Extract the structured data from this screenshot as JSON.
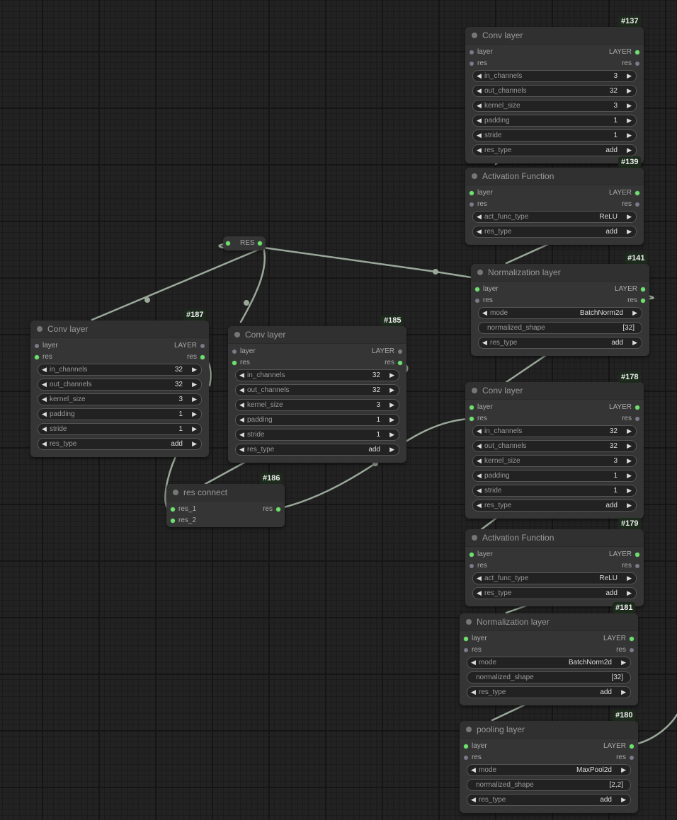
{
  "canvas": {
    "link_color": "#9aa89a",
    "slot_active_color": "#6ee06e",
    "slot_inactive_color": "#7a7a8a",
    "node_bg": "#353535",
    "badge_bg": "#1b2a1b"
  },
  "reroute": {
    "label": "RES"
  },
  "nodes": {
    "n137": {
      "id": "#137",
      "title": "Conv layer",
      "inputs": [
        "layer",
        "res"
      ],
      "outputs": [
        "LAYER",
        "res"
      ],
      "widgets": [
        {
          "name": "in_channels",
          "value": "3"
        },
        {
          "name": "out_channels",
          "value": "32"
        },
        {
          "name": "kernel_size",
          "value": "3"
        },
        {
          "name": "padding",
          "value": "1"
        },
        {
          "name": "stride",
          "value": "1"
        },
        {
          "name": "res_type",
          "value": "add"
        }
      ]
    },
    "n139": {
      "id": "#139",
      "title": "Activation Function",
      "inputs": [
        "layer",
        "res"
      ],
      "outputs": [
        "LAYER",
        "res"
      ],
      "widgets": [
        {
          "name": "act_func_type",
          "value": "ReLU"
        },
        {
          "name": "res_type",
          "value": "add"
        }
      ]
    },
    "n141": {
      "id": "#141",
      "title": "Normalization layer",
      "inputs": [
        "layer",
        "res"
      ],
      "outputs": [
        "LAYER",
        "res"
      ],
      "widgets": [
        {
          "name": "mode",
          "value": "BatchNorm2d"
        },
        {
          "name": "normalized_shape",
          "value": "[32]"
        },
        {
          "name": "res_type",
          "value": "add"
        }
      ]
    },
    "n187": {
      "id": "#187",
      "title": "Conv layer",
      "inputs": [
        "layer",
        "res"
      ],
      "outputs": [
        "LAYER",
        "res"
      ],
      "widgets": [
        {
          "name": "in_channels",
          "value": "32"
        },
        {
          "name": "out_channels",
          "value": "32"
        },
        {
          "name": "kernel_size",
          "value": "3"
        },
        {
          "name": "padding",
          "value": "1"
        },
        {
          "name": "stride",
          "value": "1"
        },
        {
          "name": "res_type",
          "value": "add"
        }
      ]
    },
    "n185": {
      "id": "#185",
      "title": "Conv layer",
      "inputs": [
        "layer",
        "res"
      ],
      "outputs": [
        "LAYER",
        "res"
      ],
      "widgets": [
        {
          "name": "in_channels",
          "value": "32"
        },
        {
          "name": "out_channels",
          "value": "32"
        },
        {
          "name": "kernel_size",
          "value": "3"
        },
        {
          "name": "padding",
          "value": "1"
        },
        {
          "name": "stride",
          "value": "1"
        },
        {
          "name": "res_type",
          "value": "add"
        }
      ]
    },
    "n186": {
      "id": "#186",
      "title": "res connect",
      "inputs": [
        "res_1",
        "res_2"
      ],
      "outputs": [
        "res"
      ]
    },
    "n178": {
      "id": "#178",
      "title": "Conv layer",
      "inputs": [
        "layer",
        "res"
      ],
      "outputs": [
        "LAYER",
        "res"
      ],
      "widgets": [
        {
          "name": "in_channels",
          "value": "32"
        },
        {
          "name": "out_channels",
          "value": "32"
        },
        {
          "name": "kernel_size",
          "value": "3"
        },
        {
          "name": "padding",
          "value": "1"
        },
        {
          "name": "stride",
          "value": "1"
        },
        {
          "name": "res_type",
          "value": "add"
        }
      ]
    },
    "n179": {
      "id": "#179",
      "title": "Activation Function",
      "inputs": [
        "layer",
        "res"
      ],
      "outputs": [
        "LAYER",
        "res"
      ],
      "widgets": [
        {
          "name": "act_func_type",
          "value": "ReLU"
        },
        {
          "name": "res_type",
          "value": "add"
        }
      ]
    },
    "n181": {
      "id": "#181",
      "title": "Normalization layer",
      "inputs": [
        "layer",
        "res"
      ],
      "outputs": [
        "LAYER",
        "res"
      ],
      "widgets": [
        {
          "name": "mode",
          "value": "BatchNorm2d"
        },
        {
          "name": "normalized_shape",
          "value": "[32]"
        },
        {
          "name": "res_type",
          "value": "add"
        }
      ]
    },
    "n180": {
      "id": "#180",
      "title": "pooling layer",
      "inputs": [
        "layer",
        "res"
      ],
      "outputs": [
        "LAYER",
        "res"
      ],
      "widgets": [
        {
          "name": "mode",
          "value": "MaxPool2d"
        },
        {
          "name": "normalized_shape",
          "value": "[2,2]"
        },
        {
          "name": "res_type",
          "value": "add"
        }
      ]
    }
  }
}
